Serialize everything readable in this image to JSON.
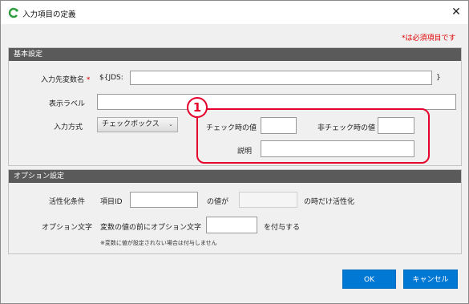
{
  "window": {
    "title": "入力項目の定義",
    "close_glyph": "✕"
  },
  "required_note": "*は必須項目です",
  "basic": {
    "header": "基本設定",
    "var_label": "入力先変数名",
    "var_required_mark": "*",
    "var_prefix": "${JDS:",
    "var_value": "",
    "var_suffix": "}",
    "display_label": "表示ラベル",
    "display_value": "",
    "input_type_label": "入力方式",
    "input_type_value": "チェックボックス",
    "checked_label": "チェック時の値",
    "checked_value": "",
    "unchecked_label": "非チェック時の値",
    "unchecked_value": "",
    "desc_label": "説明",
    "desc_value": "",
    "callout_number": "1"
  },
  "options": {
    "header": "オプション設定",
    "activate_label": "活性化条件",
    "item_id_label": "項目ID",
    "item_id_value": "",
    "value_of_label": "の値が",
    "condition_value": "",
    "only_when_label": "の時だけ活性化",
    "option_text_label": "オプション文字",
    "prefix_text": "変数の値の前にオプション文字",
    "option_text_value": "",
    "attach_text": "を付与する",
    "footnote": "※変数に値が設定されない場合は付与しません"
  },
  "buttons": {
    "ok": "OK",
    "cancel": "キャンセル"
  },
  "colors": {
    "required": "#e00000",
    "highlight": "#e4002b",
    "primary": "#0078d4",
    "section_header": "#5a5a5a"
  }
}
